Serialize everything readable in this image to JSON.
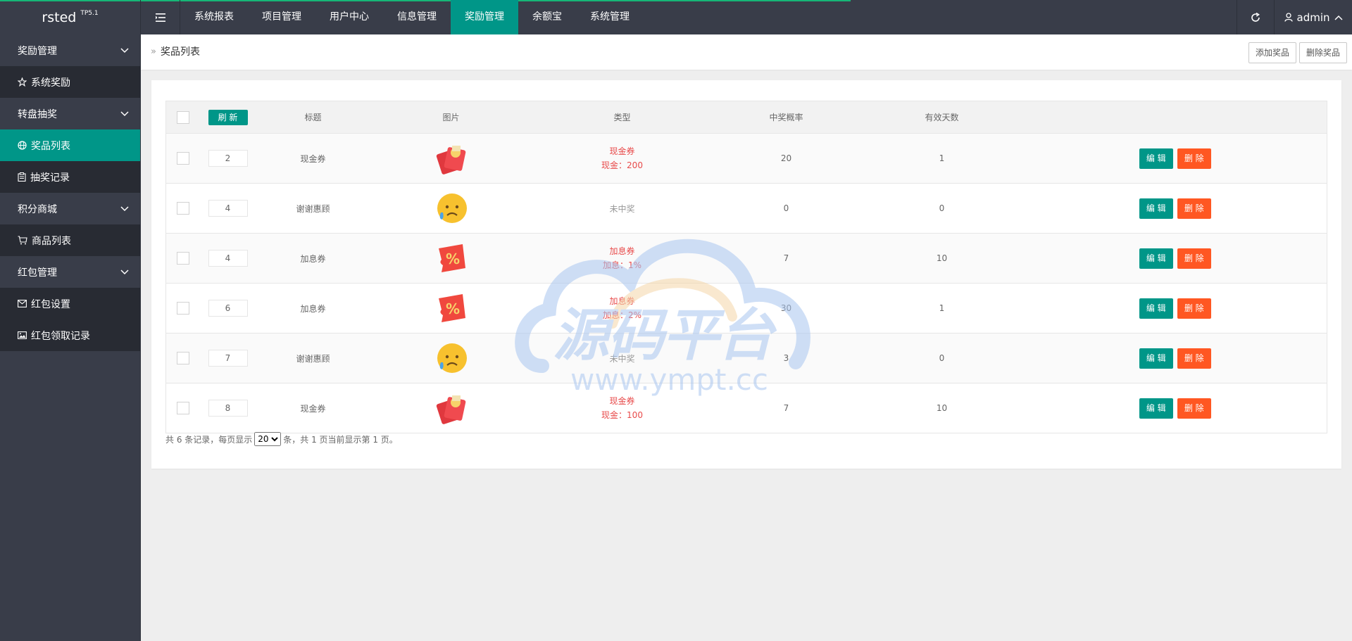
{
  "header": {
    "logo": "rsted",
    "logo_badge": "TP5.1",
    "nav": [
      {
        "label": "系统报表",
        "active": false
      },
      {
        "label": "项目管理",
        "active": false
      },
      {
        "label": "用户中心",
        "active": false
      },
      {
        "label": "信息管理",
        "active": false
      },
      {
        "label": "奖励管理",
        "active": true
      },
      {
        "label": "余额宝",
        "active": false
      },
      {
        "label": "系统管理",
        "active": false
      }
    ],
    "user": "admin"
  },
  "sidebar": {
    "groups": [
      {
        "label": "奖励管理",
        "items": [
          {
            "label": "系统奖励",
            "icon": "star-icon"
          }
        ]
      },
      {
        "label": "转盘抽奖",
        "items": [
          {
            "label": "奖品列表",
            "icon": "globe-icon",
            "active": true
          },
          {
            "label": "抽奖记录",
            "icon": "clipboard-icon"
          }
        ]
      },
      {
        "label": "积分商城",
        "items": [
          {
            "label": "商品列表",
            "icon": "cart-icon"
          }
        ]
      },
      {
        "label": "红包管理",
        "items": [
          {
            "label": "红包设置",
            "icon": "envelope-icon"
          },
          {
            "label": "红包领取记录",
            "icon": "picture-icon"
          }
        ]
      }
    ]
  },
  "breadcrumb": {
    "sep": "»",
    "current": "奖品列表"
  },
  "actions": {
    "add": "添加奖品",
    "delete": "删除奖品"
  },
  "table": {
    "refresh_label": "刷 新",
    "headers": [
      "标题",
      "图片",
      "类型",
      "中奖概率",
      "有效天数"
    ],
    "rows": [
      {
        "sort": "2",
        "title": "现金券",
        "pic": "redpacket-icon",
        "type": "现金券",
        "detail": "现金：200",
        "prob": "20",
        "days": "1",
        "win": true
      },
      {
        "sort": "4",
        "title": "谢谢惠顾",
        "pic": "sad-face-icon",
        "type": "未中奖",
        "detail": "",
        "prob": "0",
        "days": "0",
        "win": false
      },
      {
        "sort": "4",
        "title": "加息券",
        "pic": "percent-ticket-icon",
        "type": "加息券",
        "detail": "加息：1%",
        "prob": "7",
        "days": "10",
        "win": true
      },
      {
        "sort": "6",
        "title": "加息券",
        "pic": "percent-ticket-icon",
        "type": "加息券",
        "detail": "加息：2%",
        "prob": "30",
        "days": "1",
        "win": true
      },
      {
        "sort": "7",
        "title": "谢谢惠顾",
        "pic": "sad-face-icon",
        "type": "未中奖",
        "detail": "",
        "prob": "3",
        "days": "0",
        "win": false
      },
      {
        "sort": "8",
        "title": "现金券",
        "pic": "redpacket-icon",
        "type": "现金券",
        "detail": "现金：100",
        "prob": "7",
        "days": "10",
        "win": true
      }
    ],
    "edit_label": "编 辑",
    "delete_label": "删 除"
  },
  "pager": {
    "prefix": "共 6 条记录，每页显示",
    "page_size": "20",
    "suffix": "条，共 1 页当前显示第 1 页。"
  },
  "watermark": {
    "title": "源码平台",
    "url": "www.ympt.cc"
  },
  "colors": {
    "accent": "#009688",
    "danger": "#ff5722",
    "dark": "#393d49"
  }
}
